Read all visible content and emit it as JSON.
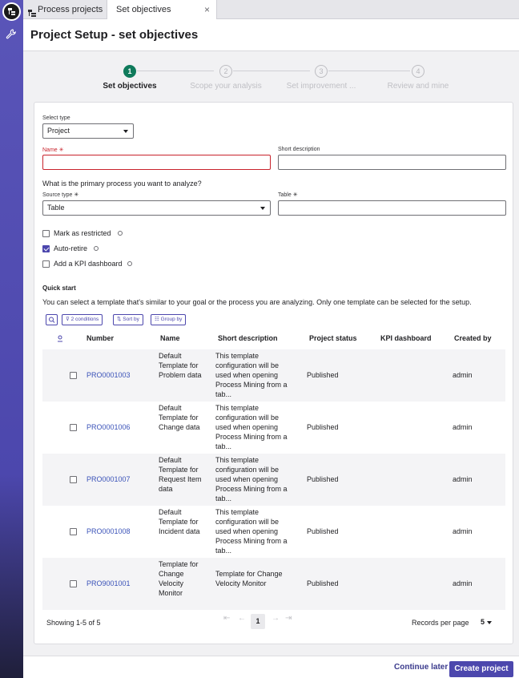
{
  "tabs": [
    {
      "label": "Process projects",
      "icon": "hierarchy-icon"
    },
    {
      "label": "Set objectives",
      "close": "×"
    }
  ],
  "page_title": "Project Setup - set objectives",
  "steps": [
    {
      "number": "1",
      "label": "Set objectives",
      "state": "active"
    },
    {
      "number": "2",
      "label": "Scope your analysis",
      "state": "inactive"
    },
    {
      "number": "3",
      "label": "Set improvement ...",
      "state": "inactive"
    },
    {
      "number": "4",
      "label": "Review and mine",
      "state": "inactive"
    }
  ],
  "form": {
    "select_type_label": "Select type",
    "select_type_value": "Project",
    "name_label": "Name",
    "required_mark": "✳",
    "name_value": "",
    "short_desc_label": "Short description",
    "short_desc_value": "",
    "question": "What is the primary process you want to analyze?",
    "source_type_label": "Source type",
    "source_type_value": "Table",
    "table_label": "Table",
    "table_value": "",
    "checkboxes": [
      {
        "label": "Mark as restricted",
        "checked": false
      },
      {
        "label": "Auto-retire",
        "checked": true
      },
      {
        "label": "Add a KPI dashboard",
        "checked": false
      }
    ]
  },
  "quick_start": {
    "title": "Quick start",
    "description": "You can select a template that's similar to your goal or the process you are analyzing. Only one template can be selected for the setup.",
    "toolbar": {
      "conditions": "2 conditions",
      "sort": "Sort by",
      "group": "Group by"
    }
  },
  "table": {
    "columns": [
      "Number",
      "Name",
      "Short description",
      "Project status",
      "KPI dashboard",
      "Created by"
    ],
    "rows": [
      {
        "number": "PRO0001003",
        "name": "Default Template for Problem data",
        "desc": "This template configuration will be used when opening Process Mining from a tab...",
        "status": "Published",
        "kpi": "",
        "created_by": "admin"
      },
      {
        "number": "PRO0001006",
        "name": "Default Template for Change data",
        "desc": "This template configuration will be used when opening Process Mining from a tab...",
        "status": "Published",
        "kpi": "",
        "created_by": "admin"
      },
      {
        "number": "PRO0001007",
        "name": "Default Template for Request Item data",
        "desc": "This template configuration will be used when opening Process Mining from a tab...",
        "status": "Published",
        "kpi": "",
        "created_by": "admin"
      },
      {
        "number": "PRO0001008",
        "name": "Default Template for Incident data",
        "desc": "This template configuration will be used when opening Process Mining from a tab...",
        "status": "Published",
        "kpi": "",
        "created_by": "admin"
      },
      {
        "number": "PRO9001001",
        "name": "Template for Change Velocity Monitor",
        "desc": "Template for Change Velocity Monitor",
        "status": "Published",
        "kpi": "",
        "created_by": "admin"
      }
    ]
  },
  "pagination": {
    "showing": "Showing 1-5 of 5",
    "current_page": "1",
    "records_label": "Records per page",
    "records_value": "5"
  },
  "actions": {
    "continue_later": "Continue later",
    "create_project": "Create project"
  },
  "colors": {
    "accent": "#4c47ad",
    "step_active": "#0f7a5b",
    "error": "#c8232c",
    "link": "#3a52b8"
  }
}
